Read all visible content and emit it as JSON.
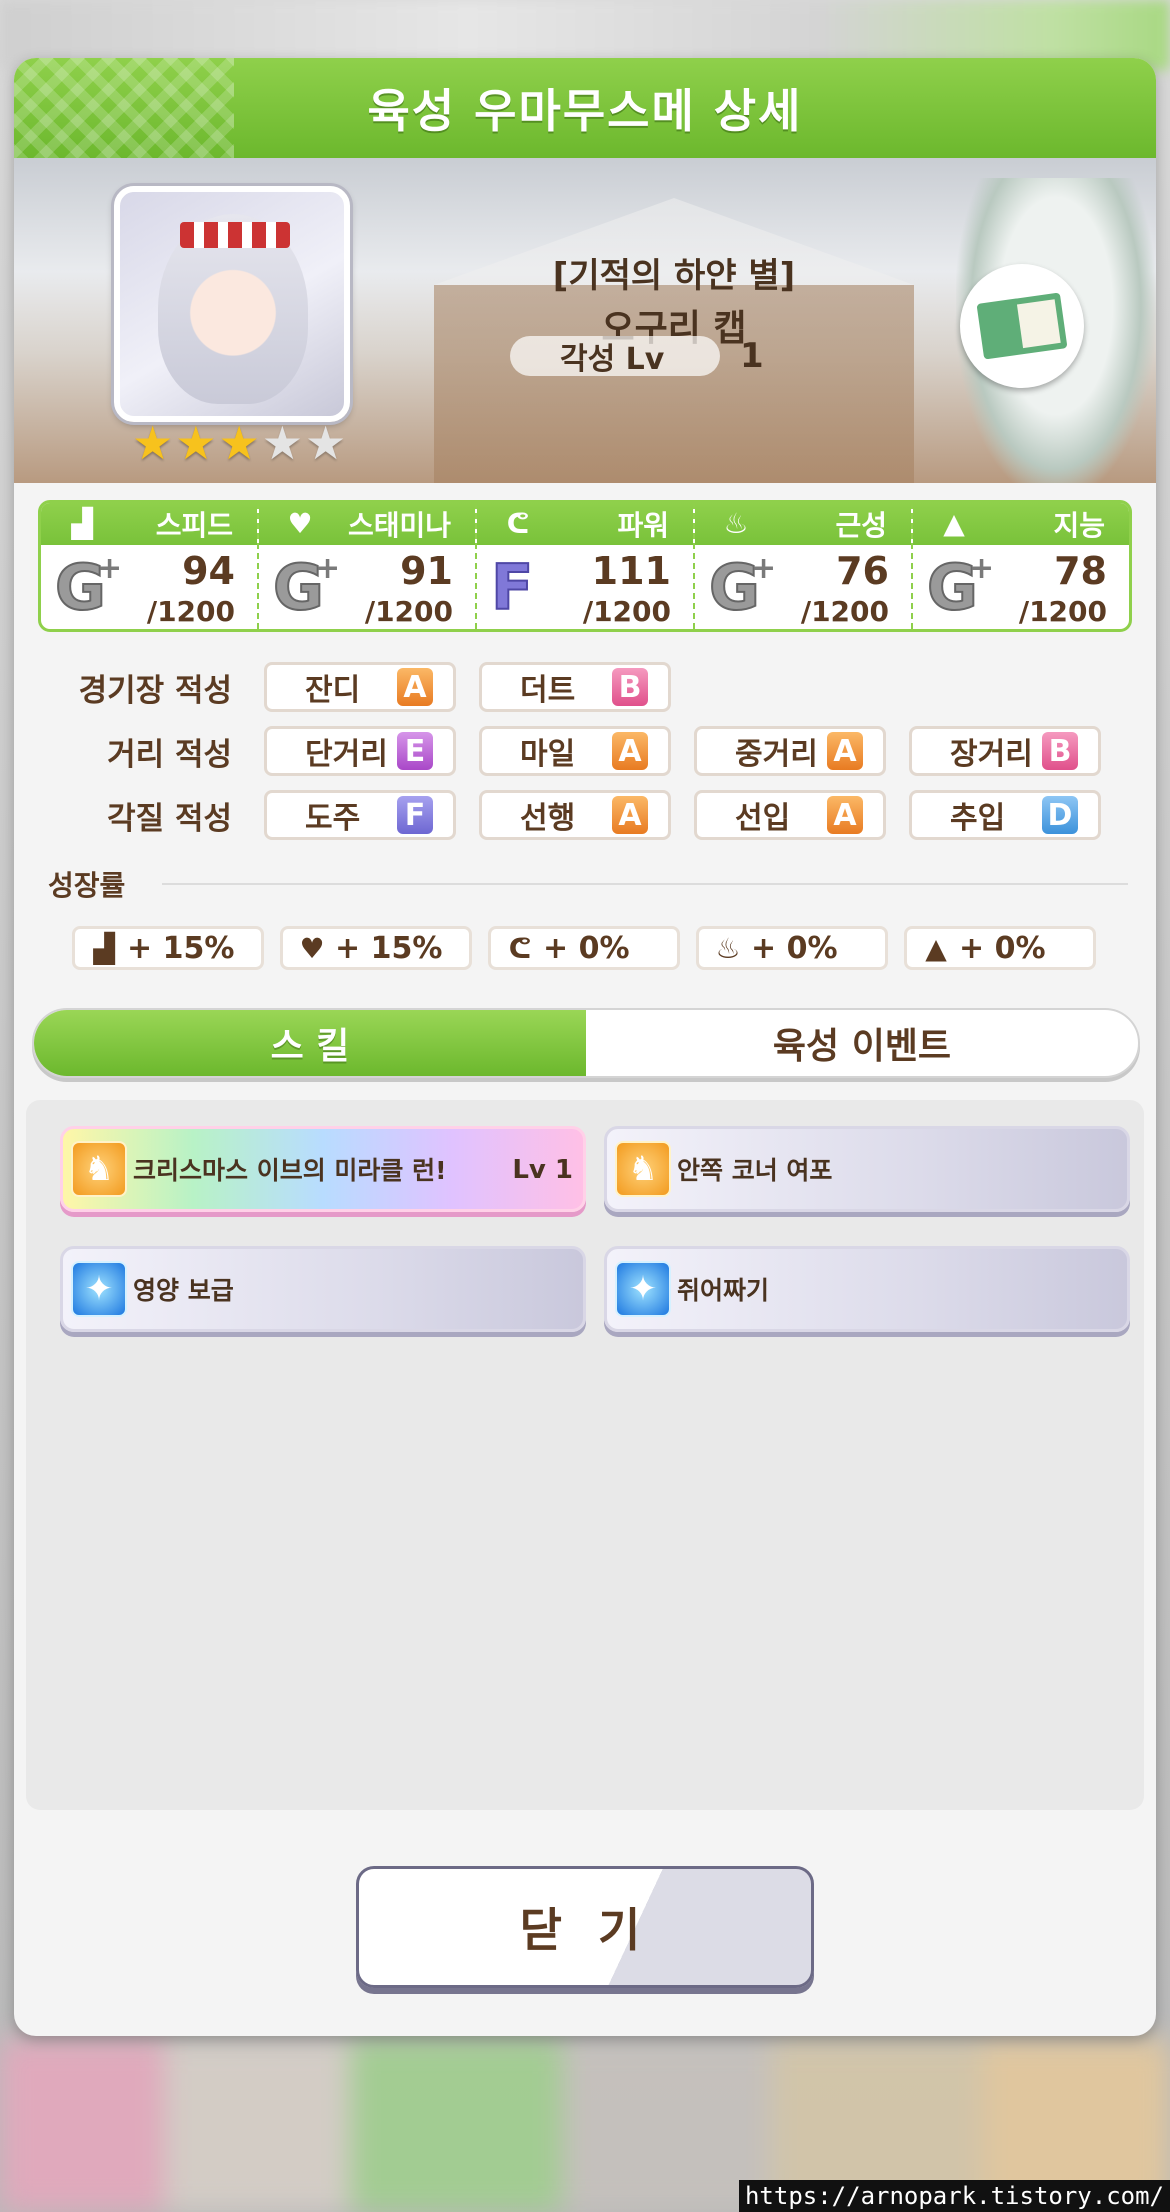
{
  "dialog": {
    "title": "육성 우마무스메 상세"
  },
  "character": {
    "epithet": "[기적의 하얀 별]",
    "name": "오구리 캡",
    "awakening_label": "각성 Lv",
    "awakening_level": "1",
    "stars_filled": 3,
    "stars_total": 5
  },
  "stats": [
    {
      "label": "스피드",
      "icon": "shoe-icon",
      "grade": "G",
      "value": "94",
      "max": "/1200"
    },
    {
      "label": "스태미나",
      "icon": "heart-icon",
      "grade": "G",
      "value": "91",
      "max": "/1200"
    },
    {
      "label": "파워",
      "icon": "muscle-icon",
      "grade": "F",
      "value": "111",
      "max": "/1200"
    },
    {
      "label": "근성",
      "icon": "flame-icon",
      "grade": "G",
      "value": "76",
      "max": "/1200"
    },
    {
      "label": "지능",
      "icon": "grad-cap-icon",
      "grade": "G",
      "value": "78",
      "max": "/1200"
    }
  ],
  "aptitude": {
    "track": {
      "label": "경기장 적성",
      "items": [
        {
          "name": "잔디",
          "grade": "A"
        },
        {
          "name": "더트",
          "grade": "B"
        }
      ]
    },
    "distance": {
      "label": "거리 적성",
      "items": [
        {
          "name": "단거리",
          "grade": "E"
        },
        {
          "name": "마일",
          "grade": "A"
        },
        {
          "name": "중거리",
          "grade": "A"
        },
        {
          "name": "장거리",
          "grade": "B"
        }
      ]
    },
    "style": {
      "label": "각질 적성",
      "items": [
        {
          "name": "도주",
          "grade": "F"
        },
        {
          "name": "선행",
          "grade": "A"
        },
        {
          "name": "선입",
          "grade": "A"
        },
        {
          "name": "추입",
          "grade": "D"
        }
      ]
    }
  },
  "growth": {
    "label": "성장률",
    "items": [
      {
        "icon": "shoe-icon",
        "value": "+ 15%"
      },
      {
        "icon": "heart-icon",
        "value": "+ 15%"
      },
      {
        "icon": "muscle-icon",
        "value": "+ 0%"
      },
      {
        "icon": "flame-icon",
        "value": "+ 0%"
      },
      {
        "icon": "grad-cap-icon",
        "value": "+ 0%"
      }
    ]
  },
  "tabs": {
    "skill": "스 킬",
    "events": "육성 이벤트",
    "active": "skill"
  },
  "skills": [
    {
      "name": "크리스마스 이브의 미라클 런!",
      "level": "Lv 1",
      "icon": "gold-horse-icon",
      "rarity": "unique"
    },
    {
      "name": "안쪽 코너 여포",
      "icon": "gold-horse-icon",
      "rarity": "normal"
    },
    {
      "name": "영양 보급",
      "icon": "blue-sparkle-icon",
      "rarity": "normal"
    },
    {
      "name": "쥐어짜기",
      "icon": "blue-sparkle-icon",
      "rarity": "normal"
    }
  ],
  "close_label": "닫 기",
  "watermark": "https://arnopark.tistory.com/"
}
